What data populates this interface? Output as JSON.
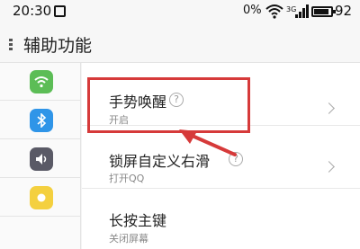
{
  "status_bar": {
    "time": "20:30",
    "battery_percent": "0%",
    "battery_number": "92"
  },
  "title_bar": {
    "title": "辅助功能"
  },
  "settings": [
    {
      "title": "手势唤醒",
      "subtitle": "开启",
      "help": "?"
    },
    {
      "title": "锁屏自定义右滑",
      "subtitle": "打开QQ",
      "help": "?"
    },
    {
      "title": "长按主键",
      "subtitle": "关闭屏幕"
    }
  ],
  "icons": [
    {
      "name": "wifi-icon",
      "color": "#5cbd56"
    },
    {
      "name": "bluetooth-icon",
      "color": "#2f95e8"
    },
    {
      "name": "sound-icon",
      "color": "#5a5a66"
    },
    {
      "name": "light-icon",
      "color": "#f4d03f"
    }
  ],
  "annotation": {
    "color": "#d63a3a"
  }
}
